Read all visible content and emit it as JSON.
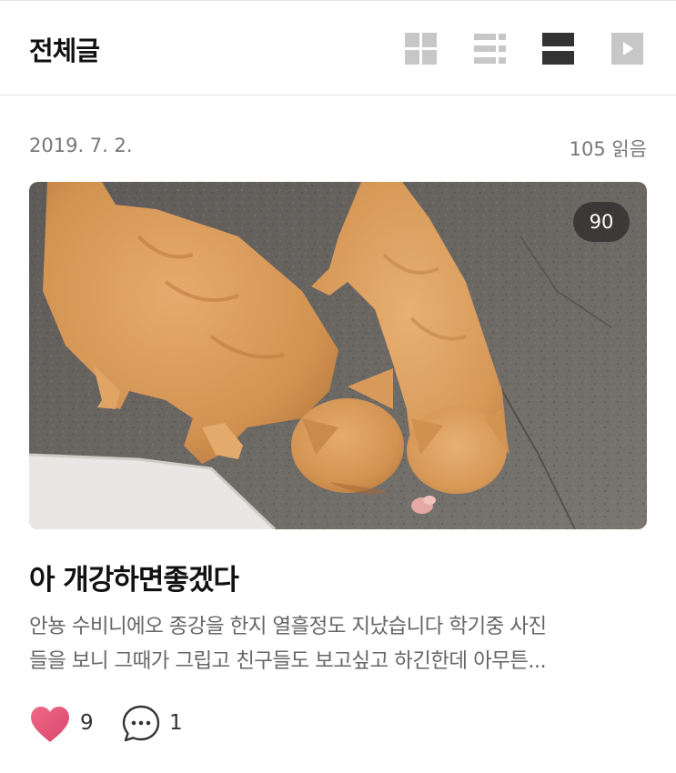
{
  "header": {
    "title": "전체글",
    "view_modes": [
      {
        "name": "grid-view",
        "icon": "grid-icon",
        "active": false
      },
      {
        "name": "list-view",
        "icon": "list-icon",
        "active": false
      },
      {
        "name": "card-view",
        "icon": "card-icon",
        "active": true
      },
      {
        "name": "slideshow-view",
        "icon": "play-icon",
        "active": false
      }
    ]
  },
  "post": {
    "date": "2019. 7. 2.",
    "views": "105 읽음",
    "image": {
      "description_icon": "photo",
      "photo_count": "90"
    },
    "title": "아 개강하면좋겠다",
    "excerpt_lines": [
      "안뇽 수비니에오 종강을 한지 열흘정도 지났습니다 학기중 사진",
      "들을 보니 그때가 그립고 친구들도 보고싶고 하긴한데 아무튼..."
    ],
    "likes": "9",
    "comments": "1"
  },
  "colors": {
    "active_icon": "#333333",
    "inactive_icon": "#c7c7c7",
    "heart": "#e8557c",
    "meta_text": "#777777"
  }
}
